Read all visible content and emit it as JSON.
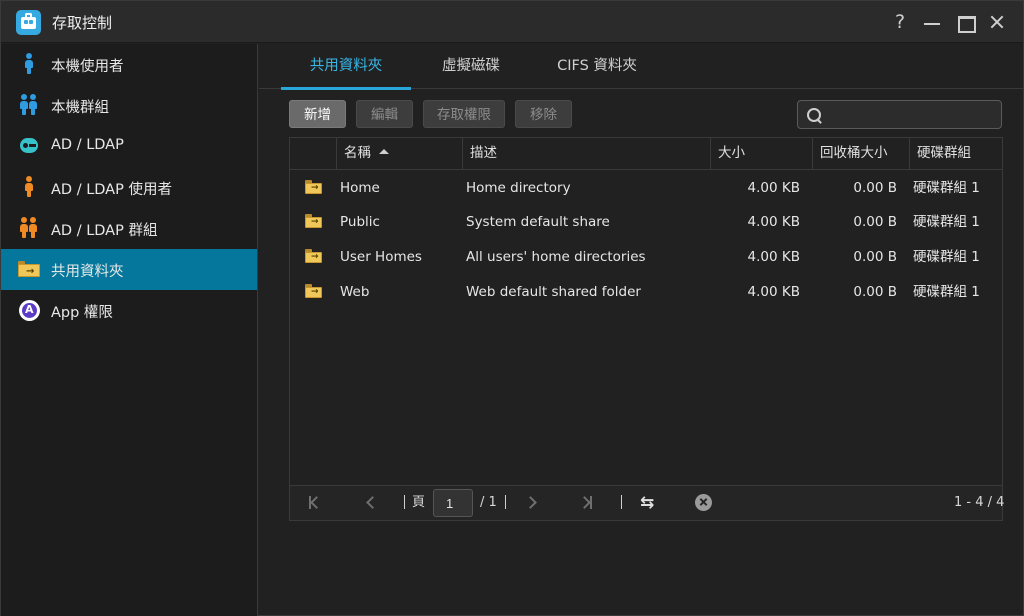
{
  "window": {
    "title": "存取控制",
    "help_symbol": "?"
  },
  "sidebar": {
    "items": [
      {
        "label": "本機使用者",
        "icon": "user-icon",
        "color": "#2f9be0"
      },
      {
        "label": "本機群組",
        "icon": "group-icon",
        "color": "#2f9be0"
      },
      {
        "label": "AD / LDAP",
        "icon": "key-icon",
        "color": "#36c2c8"
      },
      {
        "label": "AD / LDAP 使用者",
        "icon": "user-icon",
        "color": "#f08a24"
      },
      {
        "label": "AD / LDAP 群組",
        "icon": "group-icon",
        "color": "#f08a24"
      },
      {
        "label": "共用資料夾",
        "icon": "shared-folder-icon",
        "active": true
      },
      {
        "label": "App 權限",
        "icon": "app-permission-icon",
        "color": "#5b3cc4"
      }
    ]
  },
  "tabs": [
    {
      "label": "共用資料夾",
      "active": true
    },
    {
      "label": "虛擬磁碟"
    },
    {
      "label": "CIFS 資料夾"
    }
  ],
  "toolbar": {
    "add": "新增",
    "edit": "編輯",
    "access": "存取權限",
    "remove": "移除"
  },
  "search": {
    "placeholder": ""
  },
  "table": {
    "columns": [
      "名稱",
      "描述",
      "大小",
      "回收桶大小",
      "硬碟群組"
    ],
    "sort": {
      "column": "名稱",
      "direction": "ascending"
    },
    "rows": [
      {
        "name": "Home",
        "description": "Home directory",
        "size": "4.00 KB",
        "recycle": "0.00 B",
        "group": "硬碟群組 1"
      },
      {
        "name": "Public",
        "description": "System default share",
        "size": "4.00 KB",
        "recycle": "0.00 B",
        "group": "硬碟群組 1"
      },
      {
        "name": "User Homes",
        "description": "All users' home directories",
        "size": "4.00 KB",
        "recycle": "0.00 B",
        "group": "硬碟群組 1"
      },
      {
        "name": "Web",
        "description": "Web default shared folder",
        "size": "4.00 KB",
        "recycle": "0.00 B",
        "group": "硬碟群組 1"
      }
    ]
  },
  "pager": {
    "page_label": "頁",
    "current_page": "1",
    "total_pages": "/ 1",
    "range": "1 - 4 / 4"
  },
  "colors": {
    "accent": "#29a7d8",
    "active_row": "#05779c",
    "folder": "#f0c85a"
  }
}
